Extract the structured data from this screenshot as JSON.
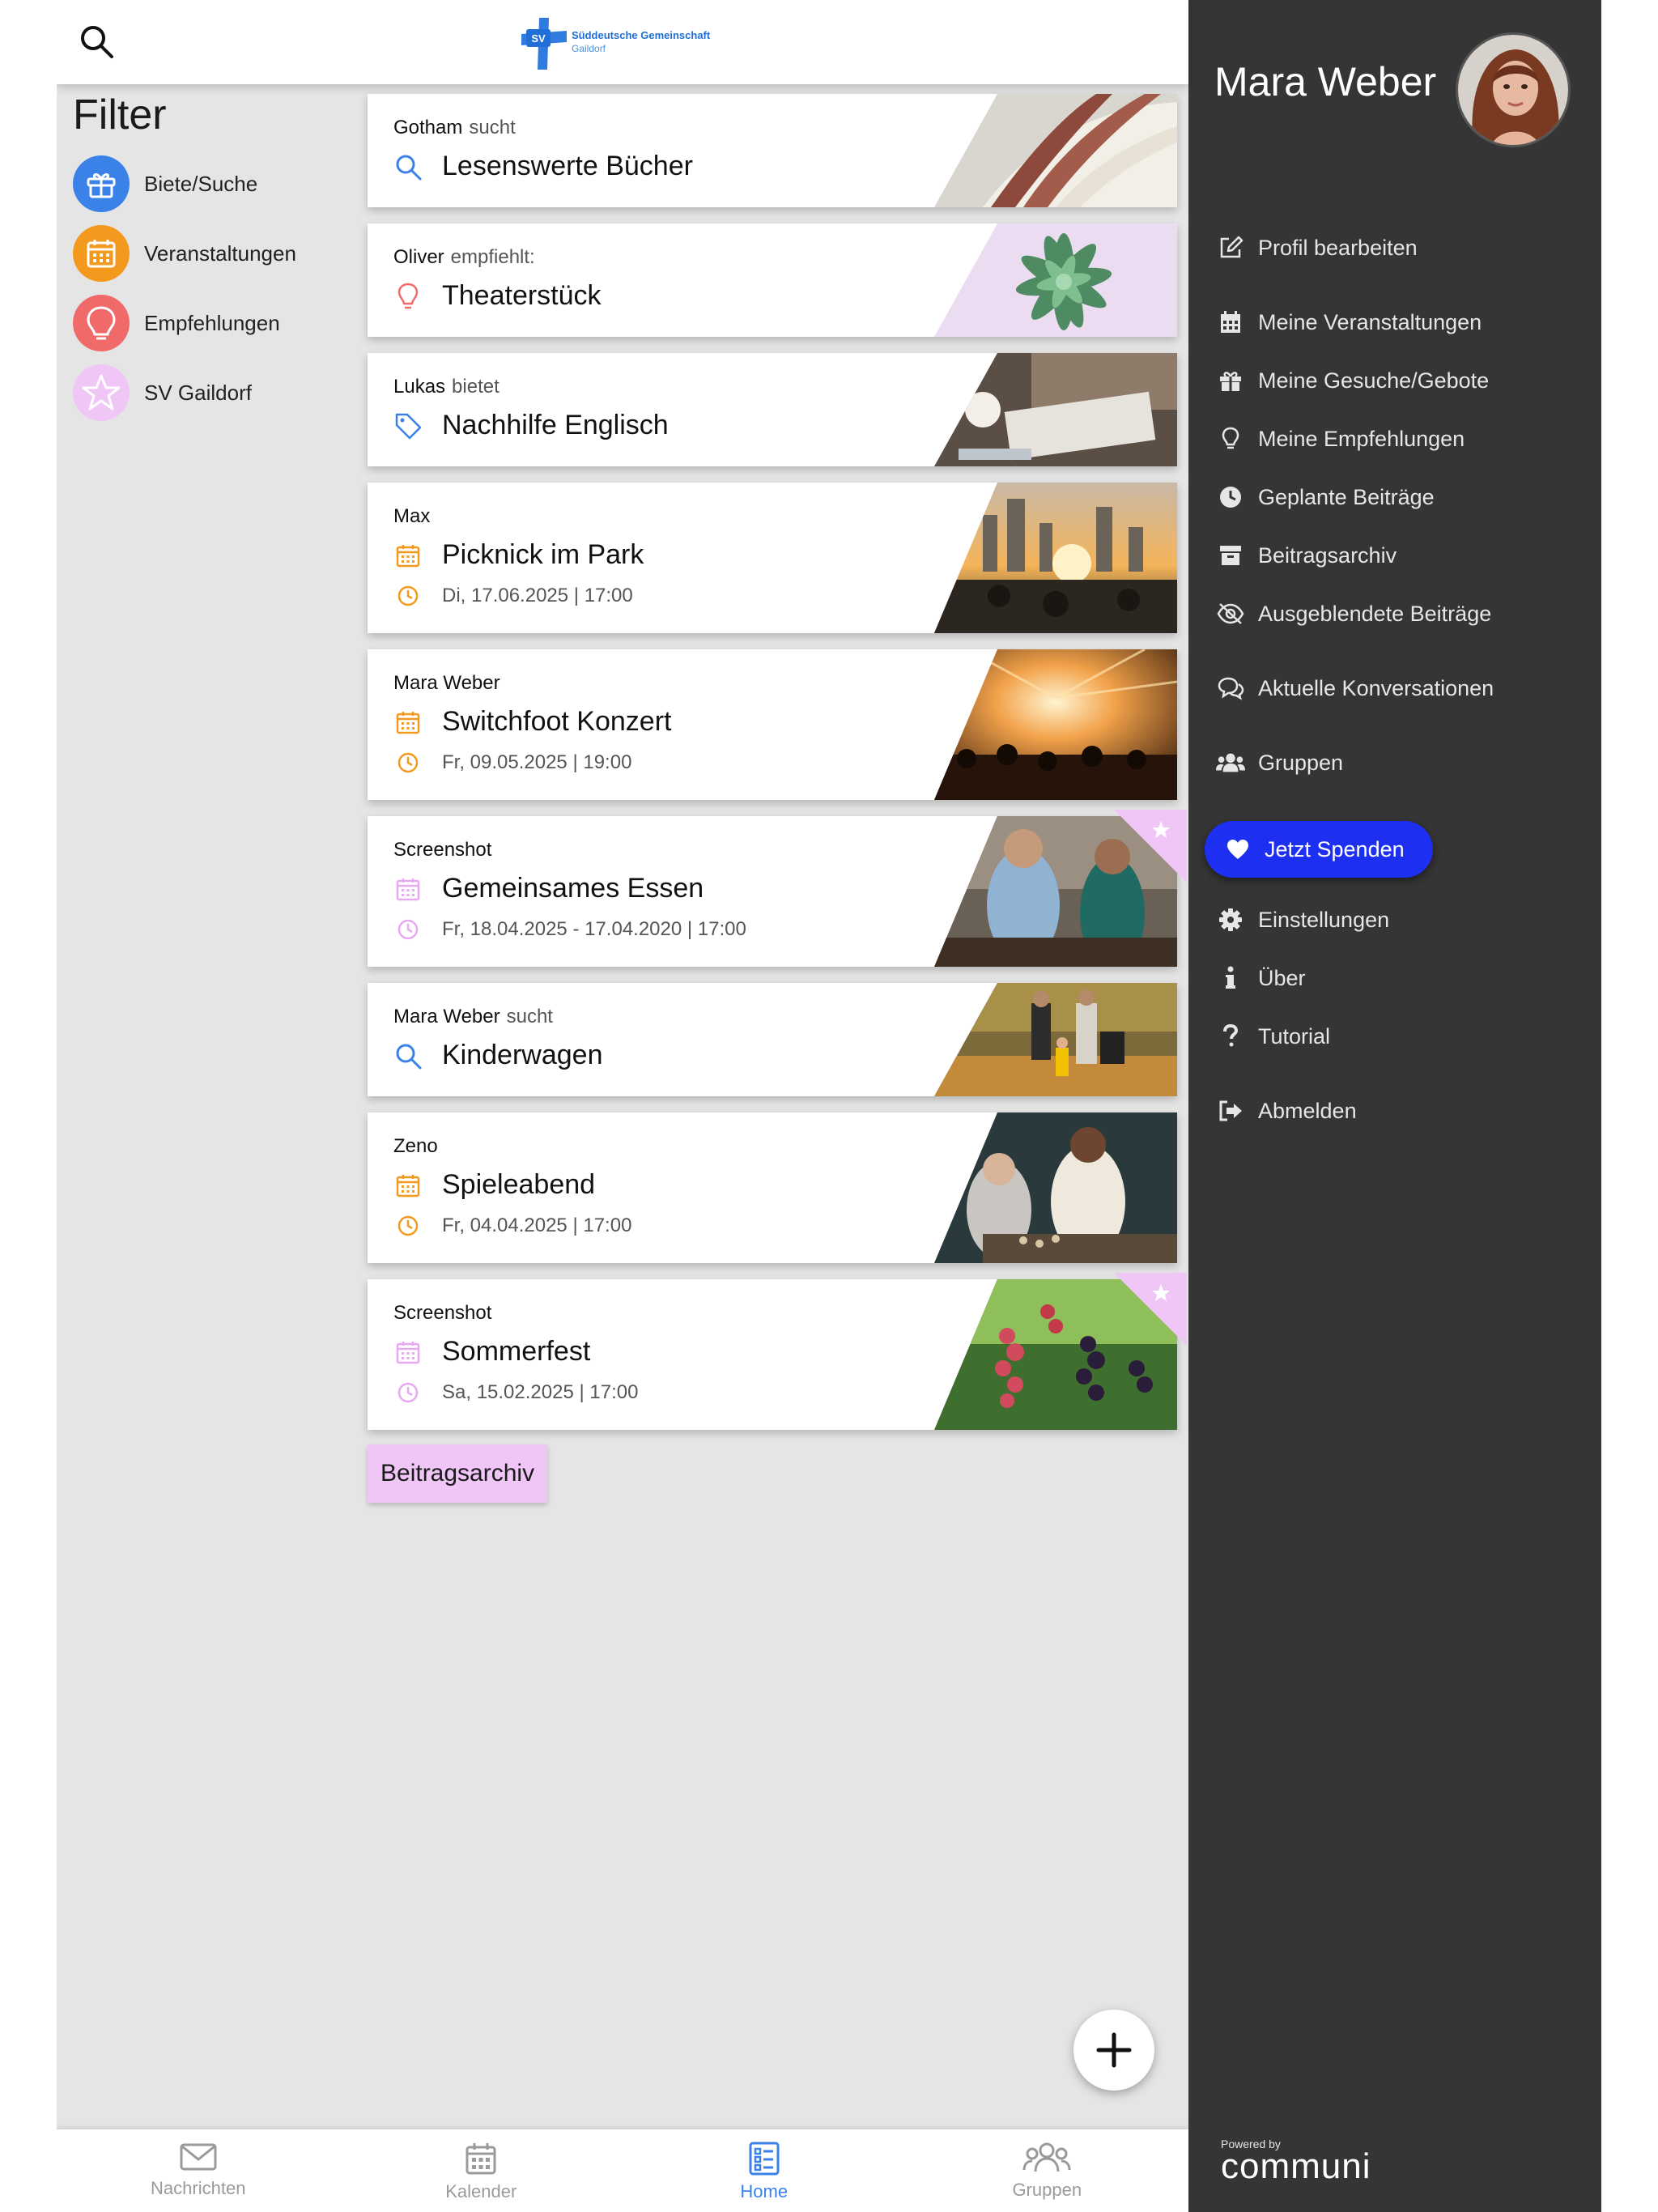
{
  "header": {
    "logo_title": "Süddeutsche Gemeinschaft",
    "logo_subtitle": "Gaildorf",
    "logo_mark": "SV"
  },
  "filter": {
    "title": "Filter",
    "items": [
      {
        "label": "Biete/Suche",
        "color": "#3b82e8"
      },
      {
        "label": "Veranstaltungen",
        "color": "#f39a1e"
      },
      {
        "label": "Empfehlungen",
        "color": "#f06a6a"
      },
      {
        "label": "SV Gaildorf",
        "color": "#f0c6f7"
      }
    ]
  },
  "feed": [
    {
      "author": "Gotham",
      "verb": "sucht",
      "title": "Lesenswerte Bücher",
      "icon": "search-icon",
      "date": ""
    },
    {
      "author": "Oliver",
      "verb": "empfiehlt:",
      "title": "Theaterstück",
      "icon": "lightbulb-icon",
      "date": ""
    },
    {
      "author": "Lukas",
      "verb": "bietet",
      "title": "Nachhilfe Englisch",
      "icon": "tag-icon",
      "date": ""
    },
    {
      "author": "Max",
      "verb": "",
      "title": "Picknick im Park",
      "icon": "calendar-icon",
      "date": "Di, 17.06.2025 | 17:00"
    },
    {
      "author": "Mara Weber",
      "verb": "",
      "title": "Switchfoot Konzert",
      "icon": "calendar-icon",
      "date": "Fr, 09.05.2025 | 19:00"
    },
    {
      "author": "Screenshot",
      "verb": "",
      "title": "Gemeinsames Essen",
      "icon": "calendar-icon",
      "date": "Fr, 18.04.2025 - 17.04.2020 | 17:00"
    },
    {
      "author": "Mara Weber",
      "verb": "sucht",
      "title": "Kinderwagen",
      "icon": "search-icon",
      "date": ""
    },
    {
      "author": "Zeno",
      "verb": "",
      "title": "Spieleabend",
      "icon": "calendar-icon",
      "date": "Fr, 04.04.2025 | 17:00"
    },
    {
      "author": "Screenshot",
      "verb": "",
      "title": "Sommerfest",
      "icon": "calendar-icon",
      "date": "Sa, 15.02.2025 | 17:00"
    }
  ],
  "archive_button": "Beitragsarchiv",
  "bottom_nav": [
    {
      "label": "Nachrichten",
      "icon": "envelope-icon"
    },
    {
      "label": "Kalender",
      "icon": "calendar-icon"
    },
    {
      "label": "Home",
      "icon": "feed-list-icon"
    },
    {
      "label": "Gruppen",
      "icon": "people-icon"
    }
  ],
  "drawer": {
    "user_name": "Mara Weber",
    "menu": [
      {
        "label": "Profil bearbeiten",
        "icon": "edit-icon"
      },
      {
        "label": "Meine Veranstaltungen",
        "icon": "calendar-icon"
      },
      {
        "label": "Meine Gesuche/Gebote",
        "icon": "gift-icon"
      },
      {
        "label": "Meine Empfehlungen",
        "icon": "lightbulb-icon"
      },
      {
        "label": "Geplante Beiträge",
        "icon": "clock-icon"
      },
      {
        "label": "Beitragsarchiv",
        "icon": "archive-icon"
      },
      {
        "label": "Ausgeblendete Beiträge",
        "icon": "eye-slash-icon"
      },
      {
        "label": "Aktuelle Konversationen",
        "icon": "chat-icon"
      },
      {
        "label": "Gruppen",
        "icon": "users-icon"
      },
      {
        "label": "Einstellungen",
        "icon": "gear-icon"
      },
      {
        "label": "Über",
        "icon": "info-icon"
      },
      {
        "label": "Tutorial",
        "icon": "question-icon"
      },
      {
        "label": "Abmelden",
        "icon": "logout-icon"
      }
    ],
    "donate_label": "Jetzt Spenden",
    "powered_by": "Powered by",
    "brand": "communi"
  },
  "colors": {
    "accent_blue": "#3b82e8",
    "event_orange": "#f39a1e",
    "recommend_red": "#f06a6a",
    "community_pink": "#f0c6f7",
    "drawer_bg": "#353535",
    "donate_blue": "#1d2ff0"
  }
}
